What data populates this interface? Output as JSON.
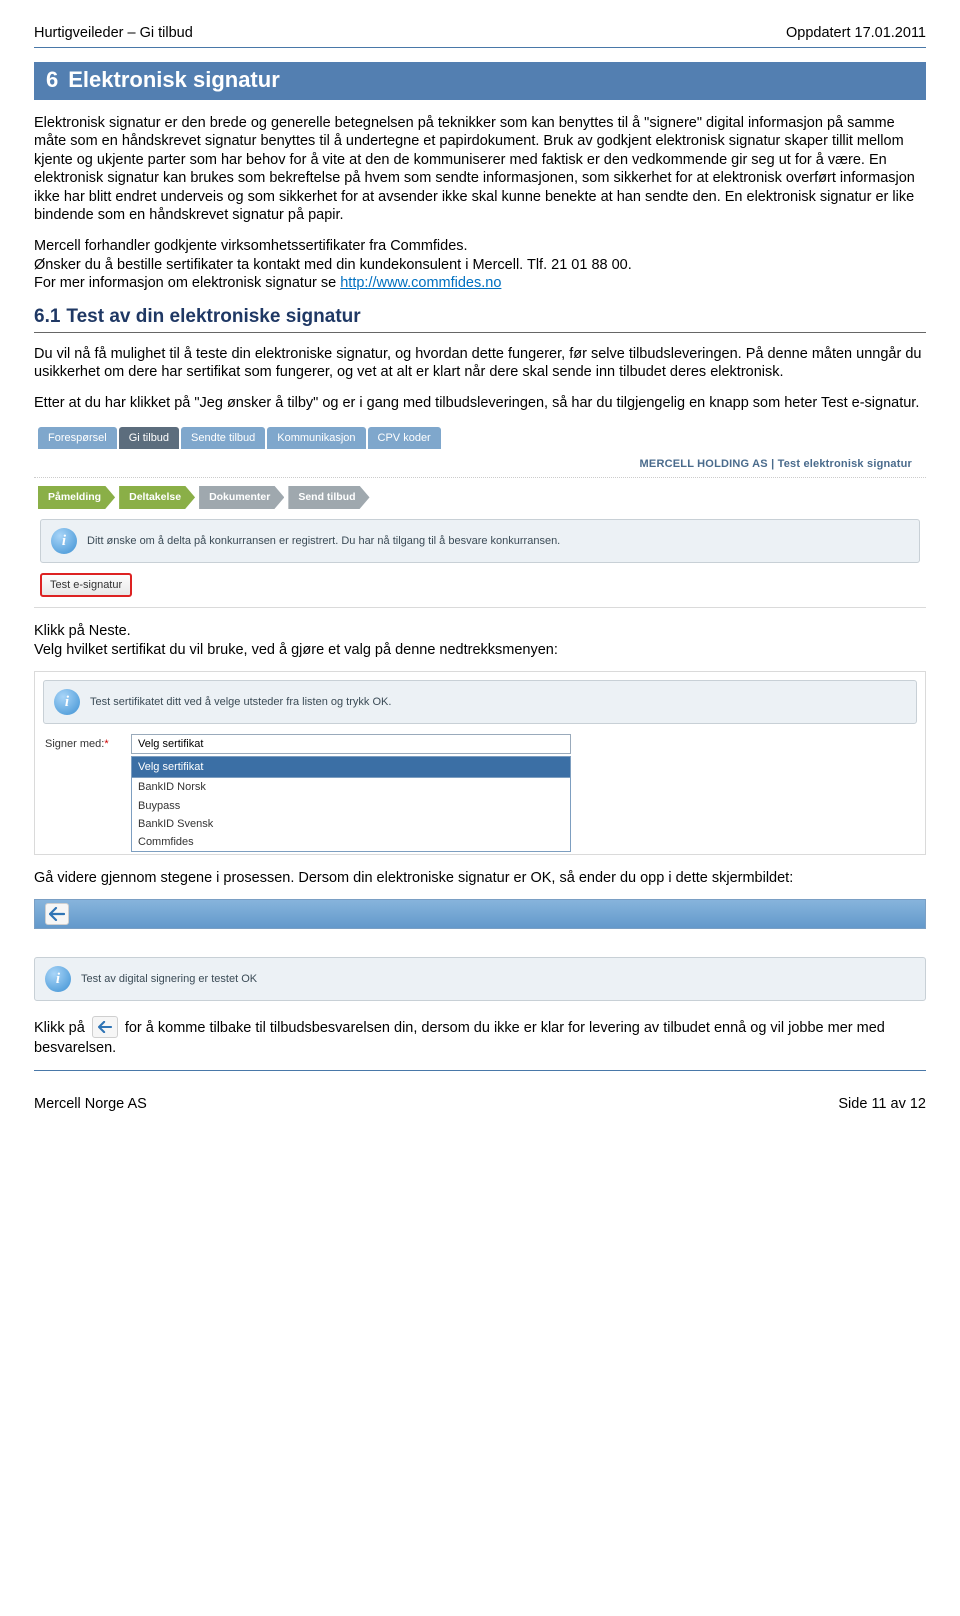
{
  "header": {
    "left": "Hurtigveileder – Gi tilbud",
    "right": "Oppdatert 17.01.2011"
  },
  "section6": {
    "num": "6",
    "title": "Elektronisk signatur",
    "para1": "Elektronisk signatur er den brede og generelle betegnelsen på teknikker som kan benyttes til å \"signere\" digital informasjon på samme måte som en håndskrevet signatur benyttes til å undertegne et papirdokument. Bruk av godkjent elektronisk signatur skaper tillit mellom kjente og ukjente parter som har behov for å vite at den de kommuniserer med faktisk er den vedkommende gir seg ut for å være. En elektronisk signatur kan brukes som bekreftelse på hvem som sendte informasjonen, som sikkerhet for at elektronisk overført informasjon ikke har blitt endret underveis og som sikkerhet for at avsender ikke skal kunne benekte at han sendte den. En elektronisk signatur er like bindende som en håndskrevet signatur på papir.",
    "para2a": "Mercell forhandler godkjente virksomhetssertifikater fra Commfides.",
    "para2b": "Ønsker du å bestille sertifikater ta kontakt med din kundekonsulent i Mercell. Tlf. 21 01 88 00.",
    "para2c_prefix": "For mer informasjon om elektronisk signatur se ",
    "link_text": "http://www.commfides.no"
  },
  "section61": {
    "num": "6.1",
    "title": "Test av din elektroniske signatur",
    "para1": "Du vil nå få mulighet til å teste din elektroniske signatur, og hvordan dette fungerer, før selve tilbudsleveringen. På denne måten unngår du usikkerhet om dere har sertifikat som fungerer, og vet at alt er klart når dere skal sende inn tilbudet deres elektronisk.",
    "para2": "Etter at du har klikket på \"Jeg ønsker å tilby\" og er i gang med tilbudsleveringen, så har du tilgjengelig en knapp som heter Test e-signatur."
  },
  "shot1": {
    "tabs": [
      "Forespørsel",
      "Gi tilbud",
      "Sendte tilbud",
      "Kommunikasjon",
      "CPV koder"
    ],
    "active_tab_index": 1,
    "breadcrumb": "MERCELL HOLDING AS | Test elektronisk signatur",
    "wizard": [
      "Påmelding",
      "Deltakelse",
      "Dokumenter",
      "Send tilbud"
    ],
    "notice": "Ditt ønske om å delta på konkurransen er registrert. Du har nå tilgang til å besvare konkurransen.",
    "btn": "Test e-signatur"
  },
  "mid": {
    "after_shot1_a": "Klikk på Neste.",
    "after_shot1_b": "Velg hvilket sertifikat du vil bruke, ved å gjøre et valg på denne nedtrekksmenyen:"
  },
  "shot2": {
    "notice": "Test sertifikatet ditt ved å velge utsteder fra listen og trykk OK.",
    "label": "Signer med:",
    "selected": "Velg sertifikat",
    "options": [
      "Velg sertifikat",
      "BankID Norsk",
      "Buypass",
      "BankID Svensk",
      "Commfides"
    ]
  },
  "mid2": {
    "para": "Gå videre gjennom stegene i prosessen. Dersom din elektroniske signatur er OK, så ender du opp i dette skjermbildet:"
  },
  "shot3": {
    "notice": "Test av digital signering er testet OK"
  },
  "final": {
    "prefix": "Klikk på ",
    "suffix": " for å komme tilbake til tilbudsbesvarelsen din, dersom du ikke er klar for levering av tilbudet ennå og vil jobbe mer med besvarelsen."
  },
  "footer": {
    "left": "Mercell Norge AS",
    "right": "Side 11 av 12"
  }
}
